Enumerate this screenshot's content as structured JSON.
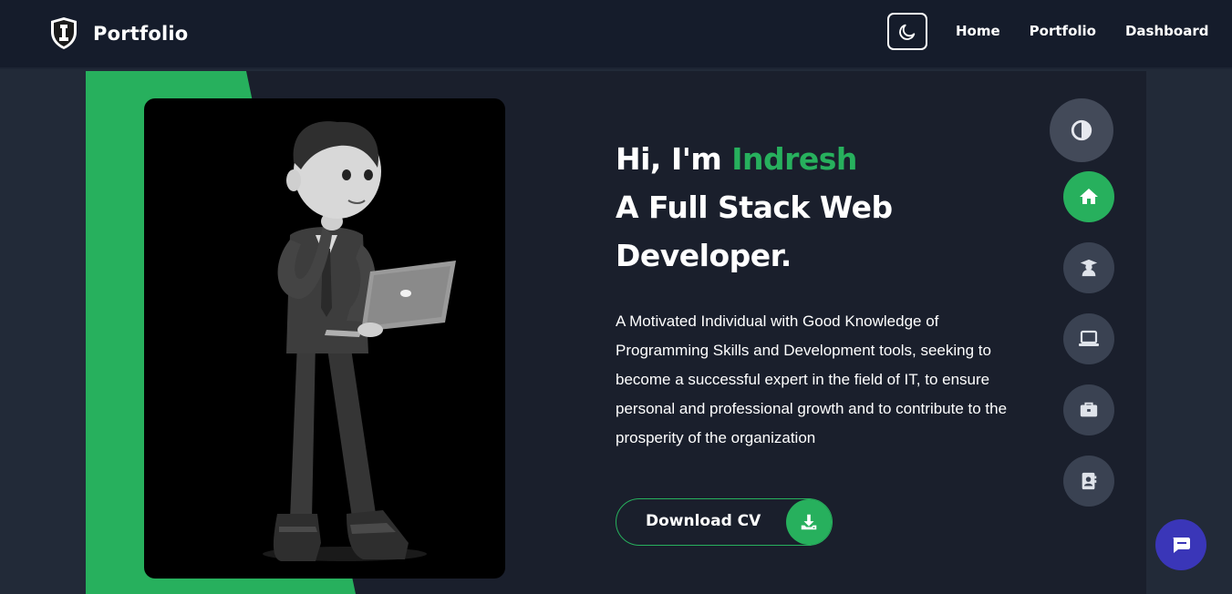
{
  "navbar": {
    "brand": "Portfolio",
    "theme_toggle_icon": "moon-icon",
    "links": [
      "Home",
      "Portfolio",
      "Dashboard"
    ]
  },
  "hero": {
    "greeting": "Hi, I'm ",
    "name": "Indresh",
    "title_line1": "A Full Stack Web",
    "title_line2": "Developer.",
    "description": "A Motivated Individual with Good Knowledge of Programming Skills and Development tools, seeking to become a successful expert in the field of IT, to ensure personal and professional growth and to contribute to the prosperity of the organization",
    "cv_button": "Download CV",
    "cv_icon": "download-icon"
  },
  "side_nav": {
    "icons": [
      "contrast-icon",
      "home-icon",
      "graduate-icon",
      "laptop-icon",
      "briefcase-icon",
      "contact-book-icon"
    ],
    "active": "home-icon"
  },
  "colors": {
    "accent": "#27b05d",
    "navbar_bg": "#151c2b",
    "panel_bg": "#1a1f2c",
    "page_bg": "#222a38",
    "chat_button": "#3a36b8"
  },
  "chat_icon": "chat-bubble-icon"
}
